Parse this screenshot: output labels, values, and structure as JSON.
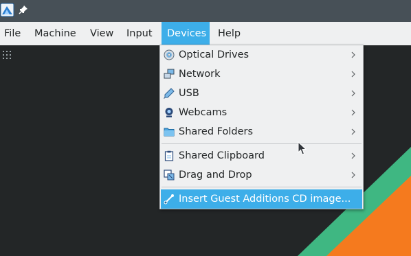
{
  "menubar": {
    "items": [
      {
        "label": "File"
      },
      {
        "label": "Machine"
      },
      {
        "label": "View"
      },
      {
        "label": "Input"
      },
      {
        "label": "Devices"
      },
      {
        "label": "Help"
      }
    ],
    "active": "Devices"
  },
  "devices_menu": {
    "items": [
      {
        "label": "Optical Drives",
        "icon": "optical-disc-icon",
        "submenu": true
      },
      {
        "label": "Network",
        "icon": "network-icon",
        "submenu": true
      },
      {
        "label": "USB",
        "icon": "usb-icon",
        "submenu": true
      },
      {
        "label": "Webcams",
        "icon": "webcam-icon",
        "submenu": true
      },
      {
        "label": "Shared Folders",
        "icon": "folder-icon",
        "submenu": true
      },
      {
        "label": "Shared Clipboard",
        "icon": "clipboard-icon",
        "submenu": true
      },
      {
        "label": "Drag and Drop",
        "icon": "drag-drop-icon",
        "submenu": true
      },
      {
        "label": "Insert Guest Additions CD image...",
        "icon": "guest-additions-icon",
        "submenu": false,
        "highlighted": true
      }
    ]
  },
  "colors": {
    "accent": "#3daee9",
    "titlebar": "#475057",
    "menubar": "#eff0f1",
    "desktop": "#232627",
    "wallpaper_green": "#3fb782",
    "wallpaper_orange": "#f57a1e"
  }
}
